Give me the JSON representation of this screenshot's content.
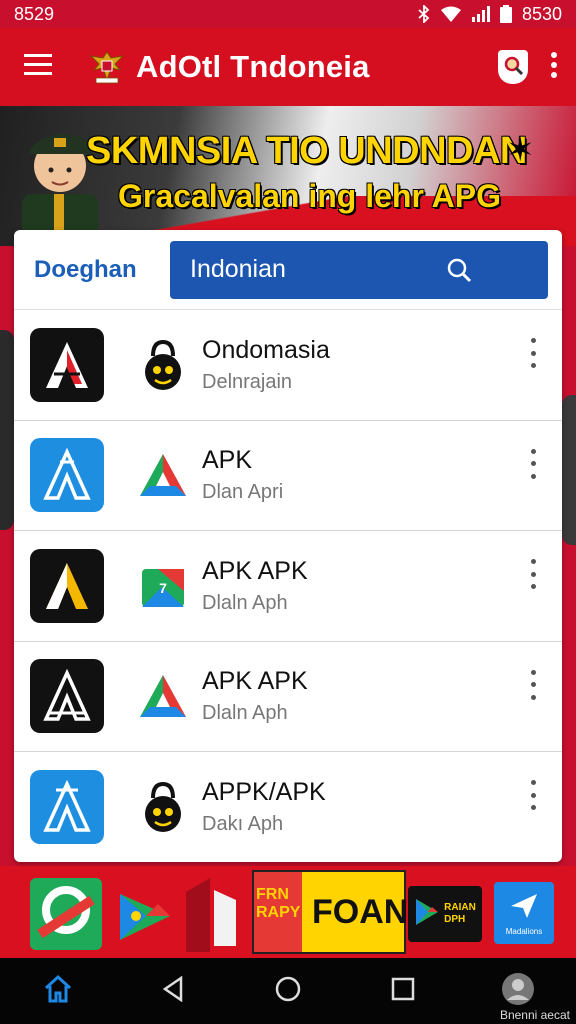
{
  "status": {
    "time": "8529",
    "battery_label": "8530"
  },
  "appbar": {
    "title": "AdOtl Tndoneia"
  },
  "banner": {
    "title": "SKMNSIA TIO UNDNDAN",
    "subtitle": "Gracalvalan ing lehr APG",
    "star": "✶"
  },
  "search": {
    "label": "Doeghan",
    "value": "Indonian"
  },
  "list": [
    {
      "title": "Ondomasia",
      "subtitle": "Delnrajain"
    },
    {
      "title": "APK",
      "subtitle": "Dlan Apri"
    },
    {
      "title": "APK APK",
      "subtitle": "Dlaln Aph"
    },
    {
      "title": "APK APK",
      "subtitle": "Dlaln Aph"
    },
    {
      "title": "APPK/APK",
      "subtitle": "Dakı Aph"
    }
  ],
  "ads": {
    "ad3_text": "FRN\nRAPY",
    "ad4_text": "FOAN",
    "ad5_text": "RAIAN\nDPH",
    "ad6_text": "Madalions"
  },
  "watermark": "Bnenni aecat",
  "colors": {
    "primary_red": "#d50f1f",
    "search_blue": "#1c56b0",
    "banner_yellow": "#ffd400",
    "navbar": "#050505"
  }
}
